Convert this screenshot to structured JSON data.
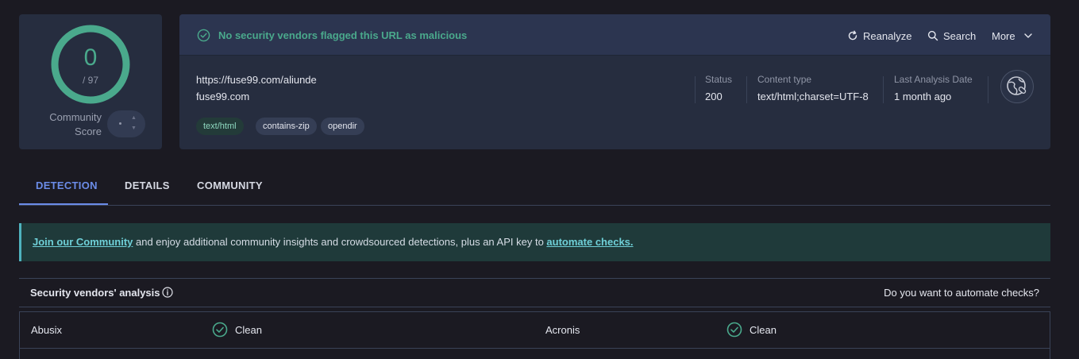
{
  "score": {
    "detections": "0",
    "total": "/ 97",
    "community_label": "Community\nScore",
    "ring_color": "#4aa98c"
  },
  "banner": {
    "message": "No security vendors flagged this URL as malicious",
    "actions": {
      "reanalyze": "Reanalyze",
      "search": "Search",
      "more": "More"
    }
  },
  "target": {
    "url": "https://fuse99.com/aliunde",
    "domain": "fuse99.com",
    "tags": [
      "text/html",
      "contains-zip",
      "opendir"
    ]
  },
  "meta": {
    "status_label": "Status",
    "status_value": "200",
    "content_type_label": "Content type",
    "content_type_value": "text/html;charset=UTF-8",
    "last_analysis_label": "Last Analysis Date",
    "last_analysis_value": "1 month ago"
  },
  "tabs": [
    "DETECTION",
    "DETAILS",
    "COMMUNITY"
  ],
  "community_banner": {
    "link1": "Join our Community",
    "middle": " and enjoy additional community insights and crowdsourced detections, plus an API key to ",
    "link2": "automate checks."
  },
  "vendors": {
    "title": "Security vendors' analysis",
    "right_link": "Do you want to automate checks?",
    "rows": [
      {
        "name": "Abusix",
        "result": "Clean",
        "name2": "Acronis",
        "result2": "Clean"
      }
    ]
  },
  "colors": {
    "accent_green": "#4aa98c",
    "accent_blue": "#6b8ce8",
    "link_teal": "#6fd0d8"
  }
}
